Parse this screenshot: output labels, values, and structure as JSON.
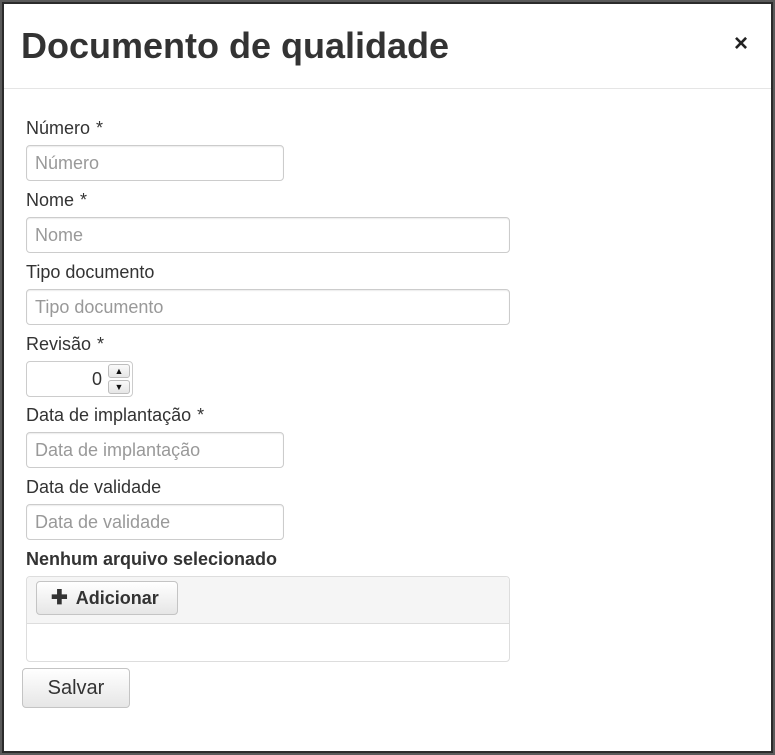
{
  "dialog": {
    "title": "Documento de qualidade",
    "close_glyph": "×"
  },
  "form": {
    "numero": {
      "label": "Número",
      "required_mark": "*",
      "placeholder": "Número",
      "value": ""
    },
    "nome": {
      "label": "Nome",
      "required_mark": "*",
      "placeholder": "Nome",
      "value": ""
    },
    "tipo_documento": {
      "label": "Tipo documento",
      "placeholder": "Tipo documento",
      "value": ""
    },
    "revisao": {
      "label": "Revisão",
      "required_mark": "*",
      "value": "0",
      "up_glyph": "▲",
      "down_glyph": "▼"
    },
    "data_implantacao": {
      "label": "Data de implantação",
      "required_mark": "*",
      "placeholder": "Data de implantação",
      "value": ""
    },
    "data_validade": {
      "label": "Data de validade",
      "placeholder": "Data de validade",
      "value": ""
    }
  },
  "upload": {
    "status": "Nenhum arquivo selecionado",
    "plus_glyph": "✚",
    "add_label": "Adicionar"
  },
  "actions": {
    "save_label": "Salvar"
  }
}
